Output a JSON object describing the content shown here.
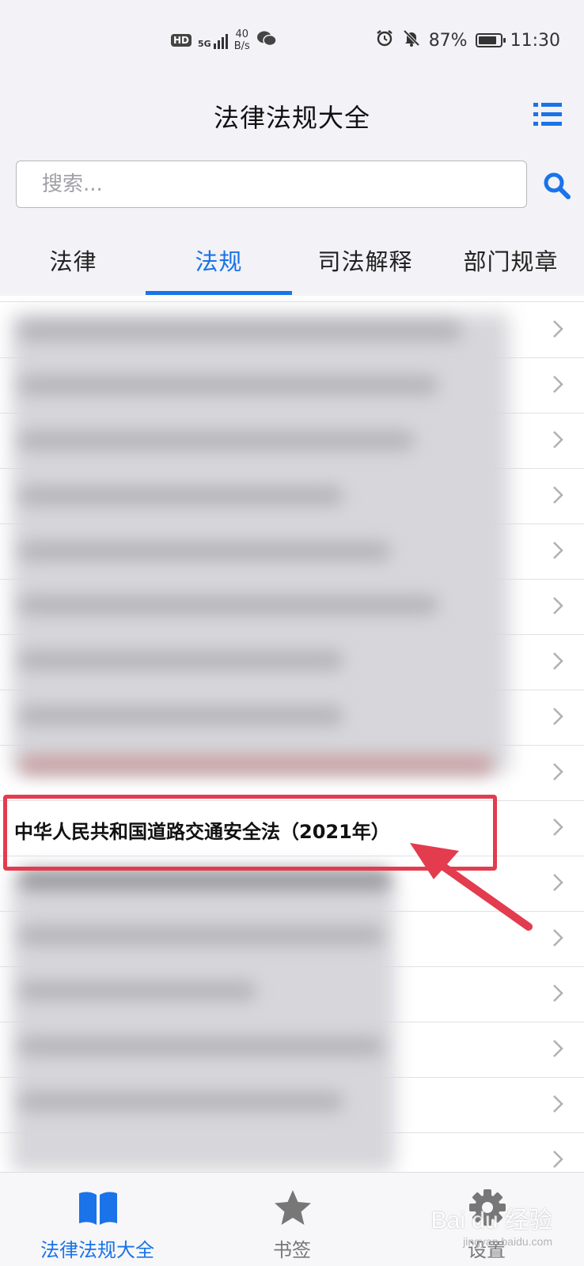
{
  "status_bar": {
    "hd_badge": "HD",
    "network": "5G",
    "speed_value": "40",
    "speed_unit": "B/s",
    "battery_percent": "87%",
    "battery_level": 0.87,
    "time": "11:30",
    "icons": [
      "hd-icon",
      "signal-icon",
      "wechat-icon",
      "alarm-icon",
      "mute-icon",
      "battery-icon"
    ]
  },
  "header": {
    "title": "法律法规大全",
    "menu_icon": "list-menu-icon"
  },
  "search": {
    "placeholder": "搜索...",
    "value": "",
    "button_icon": "search-icon"
  },
  "tabs": [
    {
      "label": "法律",
      "active": false
    },
    {
      "label": "法规",
      "active": true
    },
    {
      "label": "司法解释",
      "active": false
    },
    {
      "label": "部门规章",
      "active": false
    }
  ],
  "colors": {
    "accent": "#1a73e8",
    "highlight": "#e23c4e"
  },
  "list": {
    "highlighted_item": "中华人民共和国道路交通安全法（2021年）",
    "row_icon": "chevron-right-icon"
  },
  "bottom_nav": [
    {
      "label": "法律法规大全",
      "icon": "book-icon",
      "active": true
    },
    {
      "label": "书签",
      "icon": "star-icon",
      "active": false
    },
    {
      "label": "设置",
      "icon": "gear-icon",
      "active": false
    }
  ],
  "watermark": {
    "text": "Bai du 经验",
    "subtext": "jingyan.baidu.com"
  }
}
